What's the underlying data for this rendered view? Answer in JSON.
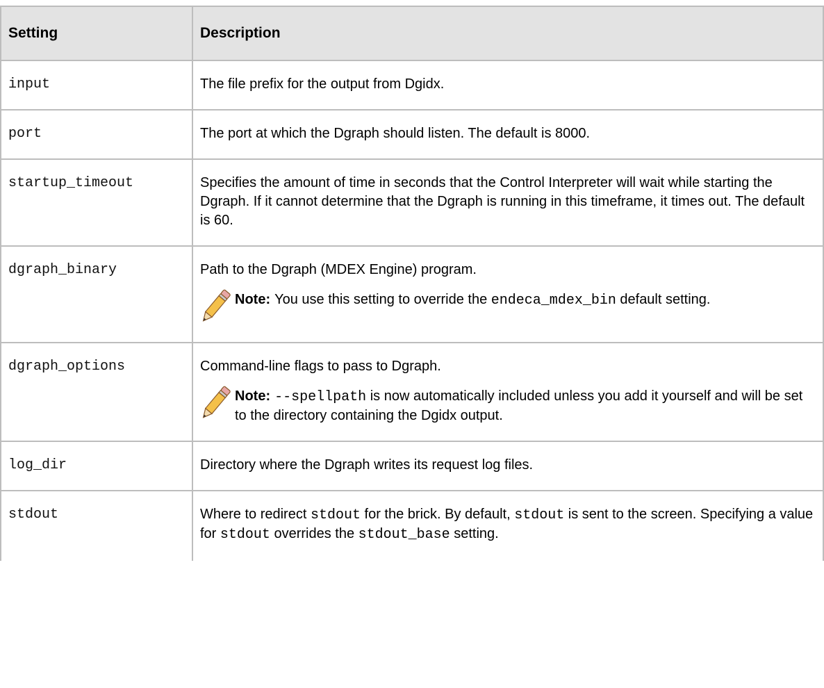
{
  "headers": {
    "setting": "Setting",
    "description": "Description"
  },
  "note_label": "Note:",
  "rows": [
    {
      "setting": "input",
      "desc": "The file prefix for the output from Dgidx."
    },
    {
      "setting": "port",
      "desc": "The port at which the Dgraph should listen. The default is 8000."
    },
    {
      "setting": "startup_timeout",
      "desc": "Specifies the amount of time in seconds that the Control Interpreter will wait while starting the Dgraph. If it cannot determine that the Dgraph is running in this timeframe, it times out. The default is 60."
    },
    {
      "setting": "dgraph_binary",
      "desc": "Path to the Dgraph (MDEX Engine) program.",
      "note": {
        "pre": "You use this setting to override the ",
        "code": "endeca_mdex_bin",
        "post": " default setting."
      }
    },
    {
      "setting": "dgraph_options",
      "desc": "Command-line flags to pass to Dgraph.",
      "note": {
        "pre": "",
        "code": "--spellpath",
        "post": " is now automatically included unless you add it yourself and will be set to the directory containing the Dgidx output."
      }
    },
    {
      "setting": "log_dir",
      "desc": "Directory where the Dgraph writes its request log files."
    },
    {
      "setting": "stdout",
      "desc_parts": [
        "Where to redirect ",
        "stdout",
        " for the brick. By default, ",
        "stdout",
        " is sent to the screen. Specifying a value for ",
        "stdout",
        " overrides the ",
        "stdout_base",
        " setting."
      ]
    }
  ]
}
